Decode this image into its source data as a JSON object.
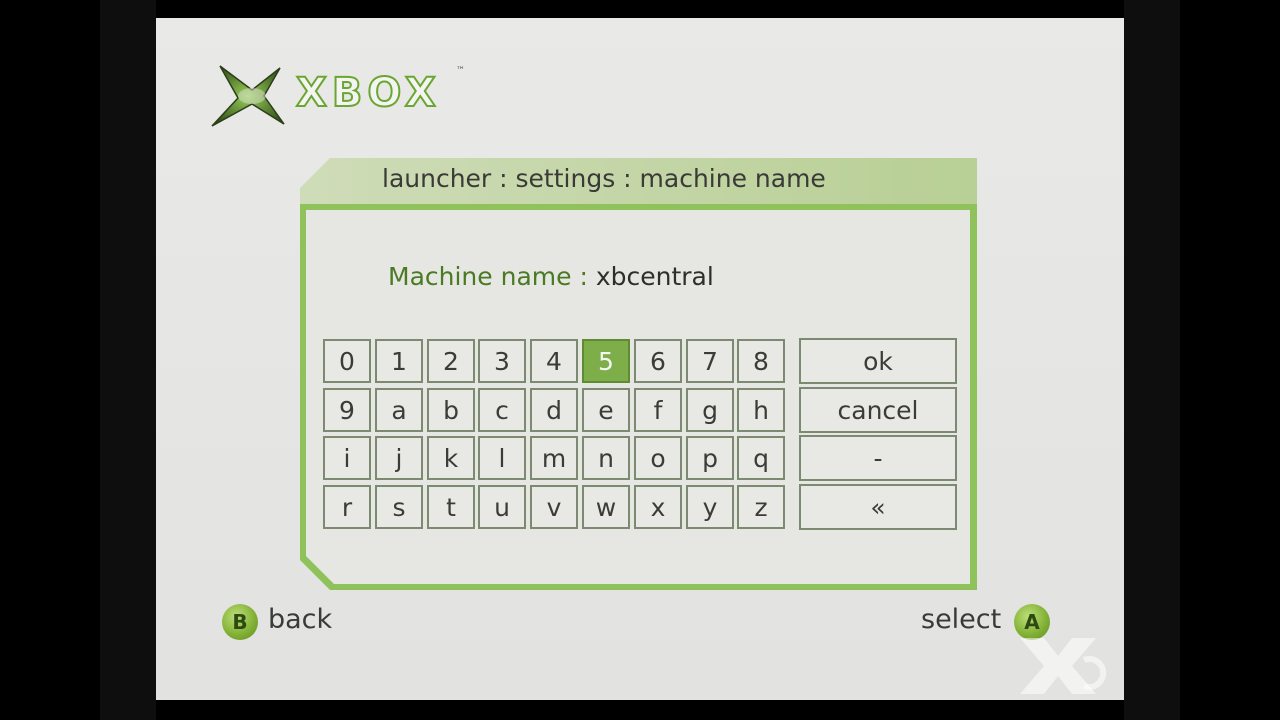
{
  "logo": {
    "text": "XBOX",
    "trademark": "™"
  },
  "breadcrumb": "launcher : settings : machine name",
  "field": {
    "label": "Machine name :",
    "value": "xbcentral"
  },
  "keyboard": {
    "rows": [
      [
        "0",
        "1",
        "2",
        "3",
        "4",
        "5",
        "6",
        "7",
        "8"
      ],
      [
        "9",
        "a",
        "b",
        "c",
        "d",
        "e",
        "f",
        "g",
        "h"
      ],
      [
        "i",
        "j",
        "k",
        "l",
        "m",
        "n",
        "o",
        "p",
        "q"
      ],
      [
        "r",
        "s",
        "t",
        "u",
        "v",
        "w",
        "x",
        "y",
        "z"
      ]
    ],
    "selected": "5",
    "actions": [
      "ok",
      "cancel",
      "-",
      "«"
    ]
  },
  "footer": {
    "back": {
      "button": "B",
      "label": "back"
    },
    "select": {
      "button": "A",
      "label": "select"
    }
  },
  "colors": {
    "accent": "#7dae4a",
    "background": "#e6e7e3",
    "border": "#8fc25a"
  }
}
